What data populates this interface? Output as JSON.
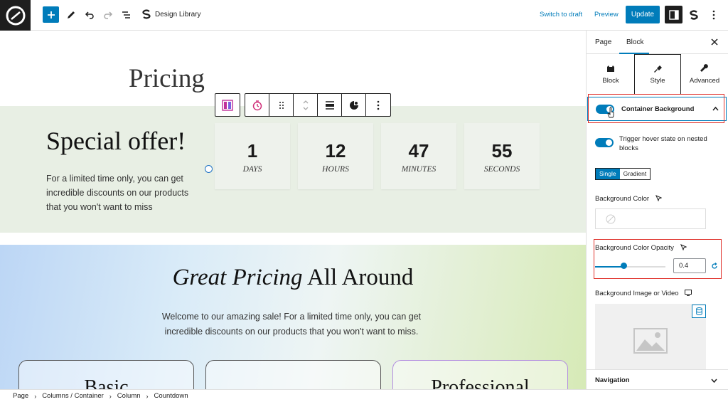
{
  "topbar": {
    "doc_title": "Design Library",
    "switch_draft": "Switch to draft",
    "preview": "Preview",
    "update": "Update"
  },
  "canvas": {
    "pricing_heading": "Pricing",
    "offer": {
      "title": "Special offer!",
      "text": "For a limited time only, you can get incredible discounts on our products that you won't want to miss"
    },
    "countdown": [
      {
        "value": "1",
        "label": "DAYS"
      },
      {
        "value": "12",
        "label": "HOURS"
      },
      {
        "value": "47",
        "label": "MINUTES"
      },
      {
        "value": "55",
        "label": "SECONDS"
      }
    ],
    "great": {
      "title_italic": "Great Pricing",
      "title_rest": " All Around",
      "text": "Welcome to our amazing sale! For a limited time only, you can get incredible discounts on our products that you won't want to miss."
    },
    "price_cards": [
      "Basic",
      "",
      "Professional"
    ]
  },
  "sidebar": {
    "tabs": [
      "Page",
      "Block"
    ],
    "subtabs": [
      "Block",
      "Style",
      "Advanced"
    ],
    "accordion_label": "Container Background",
    "hover_toggle_label": "Trigger hover state on nested blocks",
    "seg_single": "Single",
    "seg_gradient": "Gradient",
    "bg_color_label": "Background Color",
    "opacity_label": "Background Color Opacity",
    "opacity_value": "0.4",
    "opacity_fraction": 0.4,
    "bg_image_label": "Background Image or Video",
    "navigation_label": "Navigation"
  },
  "breadcrumb": [
    "Page",
    "Columns / Container",
    "Column",
    "Countdown"
  ],
  "colors": {
    "accent": "#007cba",
    "highlight": "#e0322c",
    "offer_band": "#e8efe4"
  }
}
